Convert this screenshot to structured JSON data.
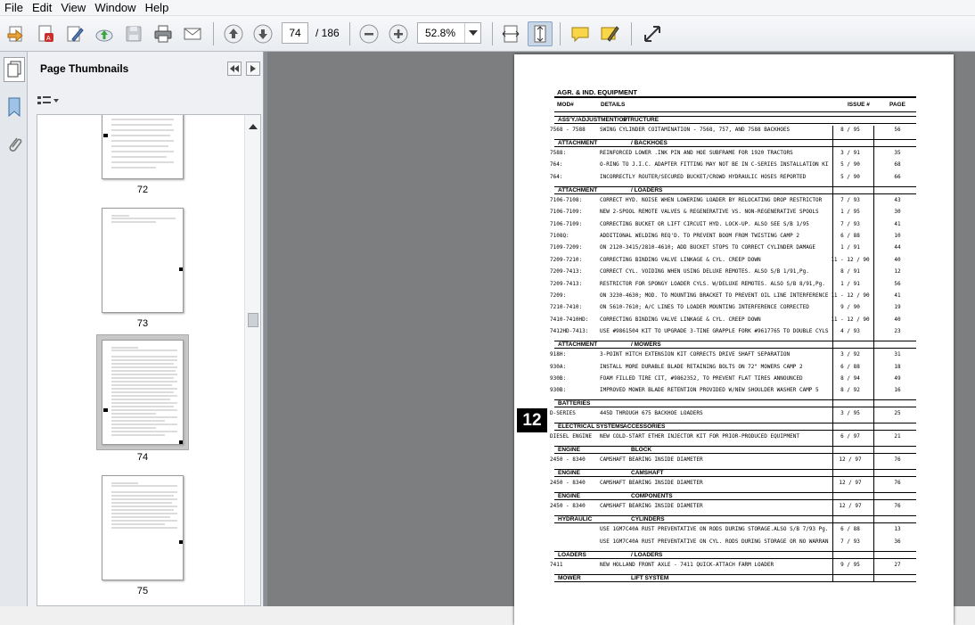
{
  "menu": [
    "File",
    "Edit",
    "View",
    "Window",
    "Help"
  ],
  "toolbar": {
    "page_current": "74",
    "page_total": "/ 186",
    "zoom": "52.8%"
  },
  "panel": {
    "title": "Page Thumbnails"
  },
  "thumbnails": [
    {
      "label": "72"
    },
    {
      "label": "73"
    },
    {
      "label": "74"
    },
    {
      "label": "75"
    }
  ],
  "doc": {
    "title": "AGR. & IND. EQUIPMENT",
    "headers": {
      "mod": "MOD#",
      "details": "DETAILS",
      "issue": "ISSUE #",
      "page": "PAGE"
    },
    "page_badge": "12",
    "sections": [
      {
        "cat": "ASS'Y./ADJUSTMENT/OP",
        "sub": "STRUCTURE",
        "rows": [
          {
            "mod": "7568 - 7588",
            "det": "SWING CYLINDER COITAMINATION - 7568, 757, AND 7588 BACKHOES",
            "iss": "8 / 95",
            "pg": "56"
          }
        ]
      },
      {
        "cat": "ATTACHMENT",
        "sub": "/ BACKHOES",
        "rows": [
          {
            "mod": "7588:",
            "det": "REINFORCED LOWER .INK PIN AND HOE SUBFRAME FOR 1920 TRACTORS",
            "iss": "3 / 91",
            "pg": "35"
          },
          {
            "mod": "764:",
            "det": "O-RING TO J.I.C. ADAPTER FITTING MAY NOT BE IN C-SERIES INSTALLATION KI",
            "iss": "5 / 90",
            "pg": "68"
          },
          {
            "mod": "764:",
            "det": "INCORRECTLY ROUTER/SECURED BUCKET/CROWD HYDRAULIC HOSES REPORTED",
            "iss": "5 / 90",
            "pg": "66"
          }
        ]
      },
      {
        "cat": "ATTACHMENT",
        "sub": "/ LOADERS",
        "rows": [
          {
            "mod": "7106-7108:",
            "det": "CORRECT HYD. NOISE WHEN LOWERING LOADER BY RELOCATING DROP RESTRICTOR",
            "iss": "7 / 93",
            "pg": "43"
          },
          {
            "mod": "7106-7109:",
            "det": "NEW 2-SPOOL REMOTE VALVES & REGENERATIVE VS. NON-REGENERATIVE SPOOLS",
            "iss": "1 / 95",
            "pg": "30"
          },
          {
            "mod": "7106-7109:",
            "det": "CORRECTING BUCKET OR LIFT CIRCUIT HYD. LOCK-UP.      ALSO SEE S/B 1/95",
            "iss": "7 / 93",
            "pg": "41"
          },
          {
            "mod": "7108Q:",
            "det": "ADDITIONAL WELDING REQ'D. TO PREVENT BOOM FROM TWISTING          CAMP 2",
            "iss": "6 / 88",
            "pg": "10"
          },
          {
            "mod": "7109-7209:",
            "det": "ON 2120-3415/2810-4610; ADD BUCKET STOPS TO CORRECT CYLINDER DAMAGE",
            "iss": "1 / 91",
            "pg": "44"
          },
          {
            "mod": "7209-7210:",
            "det": "CORRECTING BINDING VALVE LINKAGE & CYL. CREEP DOWN",
            "iss": "11 - 12 / 90",
            "pg": "40"
          },
          {
            "mod": "7209-7413:",
            "det": "CORRECT CYL. VOIDING WHEN USING DELUXE REMOTES.       ALSO S/B 1/91,Pg.",
            "iss": "8 / 91",
            "pg": "12"
          },
          {
            "mod": "7209-7413:",
            "det": "RESTRICTOR FOR SPONGY LOADER CYLS. W/DELUXE REMOTES.   ALSO S/B 8/91,Pg.",
            "iss": "1 / 91",
            "pg": "56"
          },
          {
            "mod": "7209:",
            "det": "ON 3230-4630; MOD. TO MOUNTING BRACKET TO PREVENT OIL LINE INTERFERENCE",
            "iss": "11 - 12 / 90",
            "pg": "41"
          },
          {
            "mod": "7210-7410:",
            "det": "ON 5610-7610; A/C LINES TO LOADER MOUNTING INTERFERENCE CORRECTED",
            "iss": "9 / 90",
            "pg": "19"
          },
          {
            "mod": "7410-7410HD:",
            "det": "CORRECTING BINDING VALVE LINKAGE & CYL. CREEP DOWN",
            "iss": "11 - 12 / 90",
            "pg": "40"
          },
          {
            "mod": "7412HD-7413:",
            "det": "USE #9861504 KIT TO UPGRADE 3-TINE GRAPPLE FORK #9617765 TO DOUBLE CYLS",
            "iss": "4 / 93",
            "pg": "23"
          }
        ]
      },
      {
        "cat": "ATTACHMENT",
        "sub": "/ MOWERS",
        "rows": [
          {
            "mod": "918H:",
            "det": "3-POINT HITCH EXTENSION KIT CORRECTS DRIVE SHAFT SEPARATION",
            "iss": "3 / 92",
            "pg": "31"
          },
          {
            "mod": "930A:",
            "det": "INSTALL MORE DURABLE BLADE RETAINING BOLTS ON 72\" MOWERS         CAMP 2",
            "iss": "6 / 88",
            "pg": "18"
          },
          {
            "mod": "930B:",
            "det": "FOAM FILLED TIRE CIT, #9862352, TO PREVENT FLAT TIRES ANNOUNCED",
            "iss": "8 / 94",
            "pg": "49"
          },
          {
            "mod": "930B:",
            "det": "IMPROVED MOWER BLADE RETENTION PROVIDED W/NEW SHOULDER WASHER    CAMP 5",
            "iss": "8 / 92",
            "pg": "16"
          }
        ]
      },
      {
        "cat": "BATTERIES",
        "sub": "",
        "rows": [
          {
            "mod": "D-SERIES",
            "det": "445D THROUGH 675 BACKHOE LOADERS",
            "iss": "3 / 95",
            "pg": "25"
          }
        ]
      },
      {
        "cat": "ELECTRICAL SYSTEMS",
        "sub": "ACCESSORIES",
        "rows": [
          {
            "mod": "DIESEL ENGINE",
            "det": "NEW COLD-START ETHER INJECTOR KIT FOR PRIOR-PRODUCED EQUIPMENT",
            "iss": "6 / 97",
            "pg": "21"
          }
        ]
      },
      {
        "cat": "ENGINE",
        "sub": "BLOCK",
        "rows": [
          {
            "mod": "2450 - 8340",
            "det": "CAMSHAFT BEARING INSIDE DIAMETER",
            "iss": "12 / 97",
            "pg": "76"
          }
        ]
      },
      {
        "cat": "ENGINE",
        "sub": "CAMSHAFT",
        "rows": [
          {
            "mod": "2450 - 8340",
            "det": "CAMSHAFT BEARING INSIDE DIAMETER",
            "iss": "12 / 97",
            "pg": "76"
          }
        ]
      },
      {
        "cat": "ENGINE",
        "sub": "COMPONENTS",
        "rows": [
          {
            "mod": "2450 - 8340",
            "det": "CAMSHAFT BEARING INSIDE DIAMETER",
            "iss": "12 / 97",
            "pg": "76"
          }
        ]
      },
      {
        "cat": "HYDRAULIC",
        "sub": "CYLINDERS",
        "rows": [
          {
            "mod": "",
            "det": "USE 1GM7C40A RUST PREVENTATIVE ON RODS DURING STORAGE.ALSO S/B 7/93 Pg.",
            "iss": "6 / 88",
            "pg": "13"
          },
          {
            "mod": "",
            "det": "USE 1GM7C40A RUST PREVENTATIVE ON CYL. RODS DURING STORAGE OR NO WARRAN",
            "iss": "7 / 93",
            "pg": "36"
          }
        ]
      },
      {
        "cat": "LOADERS",
        "sub": "/ LOADERS",
        "rows": [
          {
            "mod": "7411",
            "det": "NEW HOLLAND FRONT AXLE - 7411 QUICK-ATTACH FARM LOADER",
            "iss": "9 / 95",
            "pg": "27"
          }
        ]
      },
      {
        "cat": "MOWER",
        "sub": "LIFT SYSTEM",
        "rows": []
      }
    ]
  }
}
